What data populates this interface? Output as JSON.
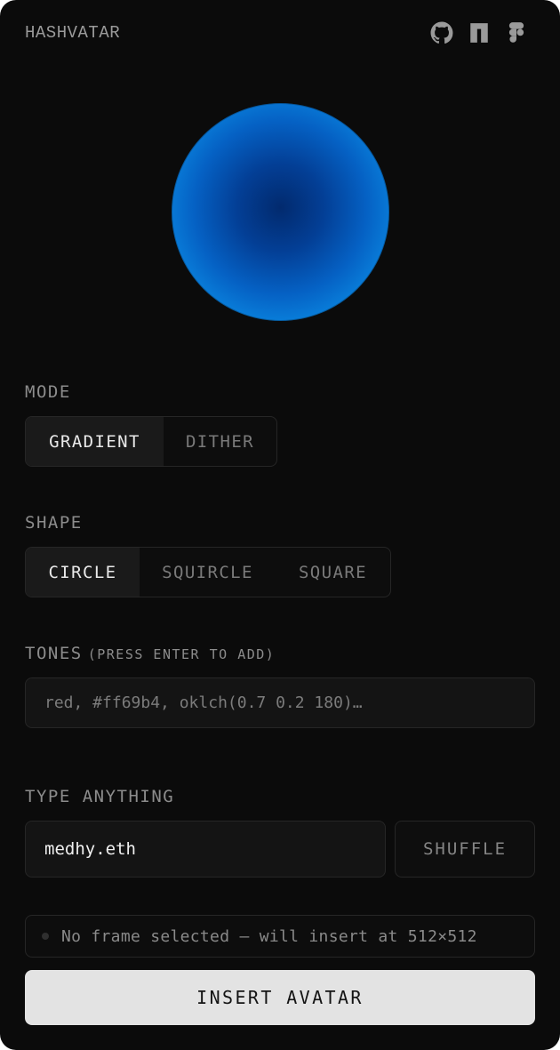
{
  "header": {
    "title": "HASHVATAR",
    "icons": [
      "github-icon",
      "notion-icon",
      "figma-icon"
    ]
  },
  "avatar": {
    "shape": "circle",
    "colors": {
      "center": "#022a6e",
      "edge": "#13a0f6"
    }
  },
  "mode": {
    "label": "MODE",
    "options": [
      "GRADIENT",
      "DITHER"
    ],
    "selected": "GRADIENT"
  },
  "shape": {
    "label": "SHAPE",
    "options": [
      "CIRCLE",
      "SQUIRCLE",
      "SQUARE"
    ],
    "selected": "CIRCLE"
  },
  "tones": {
    "label": "TONES",
    "hint": "(PRESS ENTER TO ADD)",
    "placeholder": "red, #ff69b4, oklch(0.7 0.2 180)…",
    "value": ""
  },
  "input": {
    "label": "TYPE ANYTHING",
    "value": "medhy.eth",
    "shuffle_label": "SHUFFLE"
  },
  "status": {
    "text": "No frame selected — will insert at 512×512"
  },
  "actions": {
    "insert_label": "INSERT AVATAR"
  },
  "colors": {
    "panel_bg": "#0b0b0b",
    "button_bg": "#e3e3e3",
    "muted_text": "#8c8c8c",
    "border": "#262626"
  }
}
